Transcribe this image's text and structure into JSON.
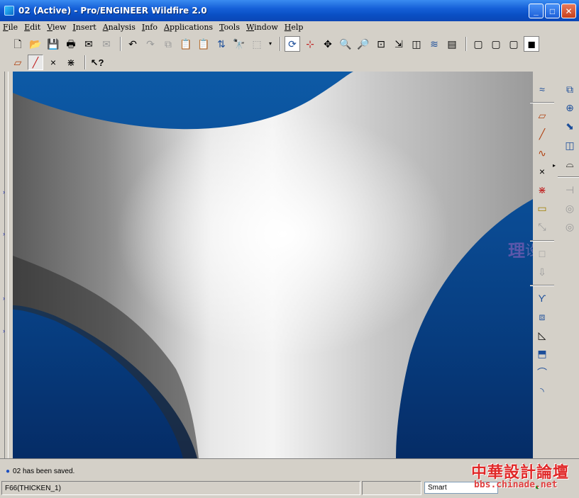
{
  "window": {
    "title": "02 (Active) - Pro/ENGINEER Wildfire 2.0",
    "minimize_glyph": "_",
    "maximize_glyph": "□",
    "close_glyph": "✕"
  },
  "menu": [
    "File",
    "Edit",
    "View",
    "Insert",
    "Analysis",
    "Info",
    "Applications",
    "Tools",
    "Window",
    "Help"
  ],
  "toolbar_icons": {
    "new": "🗋",
    "open": "📂",
    "save": "💾",
    "print": "🖶",
    "send": "✉",
    "undo": "↶",
    "redo": "↷",
    "copy": "⧉",
    "paste": "📋",
    "paste_special": "📋",
    "regenerate": "⇅",
    "find": "🔭",
    "select_box": "⬚",
    "dropdown": "▾",
    "repaint": "⟳",
    "spin_center": "⊹",
    "orient": "✥",
    "zoom_in": "🔍",
    "zoom_out": "🔎",
    "refit": "⊡",
    "saved_views": "⇲",
    "view_manager": "◫",
    "layers": "≋",
    "model_tree": "▤",
    "wireframe": "▢",
    "hidden_line": "▢",
    "no_hidden": "▢",
    "shading": "◼",
    "datum_planes": "▱",
    "datum_axes": "╱",
    "datum_points": "×",
    "csys": "⋇",
    "whats_this": "↖?"
  },
  "right_tools_col1": [
    "≈",
    "▱",
    "╱",
    "∿",
    "×",
    "⋇",
    "▭",
    "⤡",
    "□",
    "⇩",
    "ϒ",
    "⧈",
    "◺",
    "⬒",
    "⌒",
    "◝"
  ],
  "right_tools_col2": [
    "⧉",
    "⊕",
    "⬊",
    "◫",
    "⌓",
    "⊣",
    "◎",
    "◎"
  ],
  "right_tools_flyout": "▸",
  "messages": {
    "last": "02 has been saved."
  },
  "status": {
    "selection": "F66(THICKEN_1)",
    "filter": "Smart"
  },
  "watermarks": {
    "logo_main": "中華設計論壇",
    "logo_url": "bbs.chinade.net",
    "overlay_glyph": "理",
    "overlay_glyph2": "设计"
  },
  "colors": {
    "titlebar": "#0a4fc4",
    "viewport_bg_top": "#0d5aa6",
    "viewport_bg_bottom": "#052c66",
    "model_surface": "#e0e0e0"
  }
}
